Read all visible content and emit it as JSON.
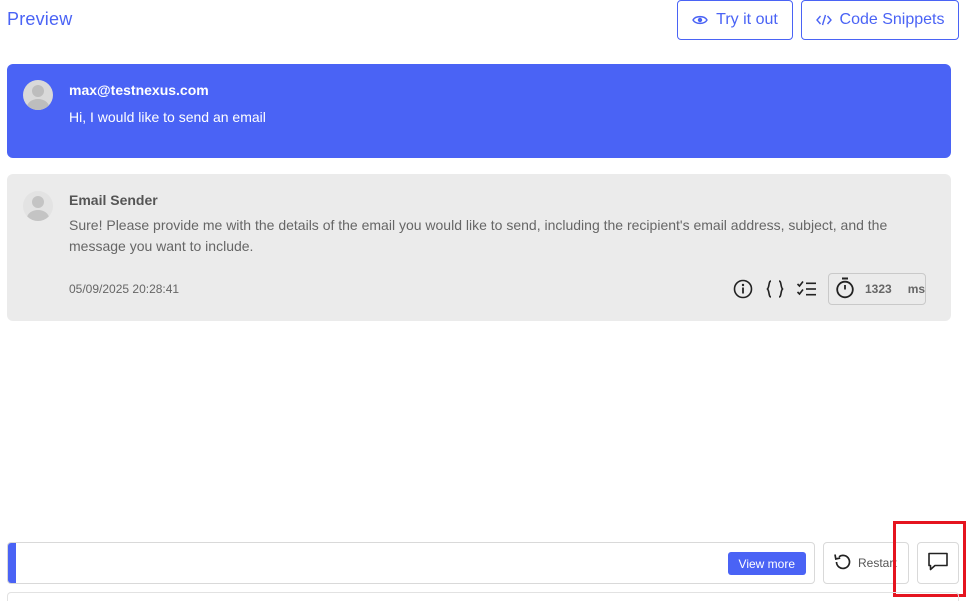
{
  "header": {
    "title": "Preview",
    "try_it_out_label": "Try it out",
    "code_snippets_label": "Code Snippets"
  },
  "conversation": {
    "user_message": {
      "sender": "max@testnexus.com",
      "text": "Hi, I would like to send an email"
    },
    "bot_message": {
      "sender": "Email Sender",
      "text": "Sure! Please provide me with the details of the email you would like to send, including the recipient's email address, subject, and the message you want to include.",
      "timestamp": "05/09/2025 20:28:41",
      "response_time_value": "1323",
      "response_time_unit": "ms"
    }
  },
  "input_area": {
    "view_more_label": "View more",
    "restart_label": "Restart"
  },
  "icons": {
    "try_it_out": "eye-icon",
    "code_snippets": "code-icon",
    "info": "info-icon",
    "json": "braces-icon",
    "checklist": "checklist-icon",
    "timer": "stopwatch-icon",
    "restart": "restart-icon",
    "chat": "chat-bubble-icon"
  },
  "colors": {
    "accent": "#4a63f5",
    "bot_background": "#ebebeb",
    "highlight": "#e5141f"
  }
}
